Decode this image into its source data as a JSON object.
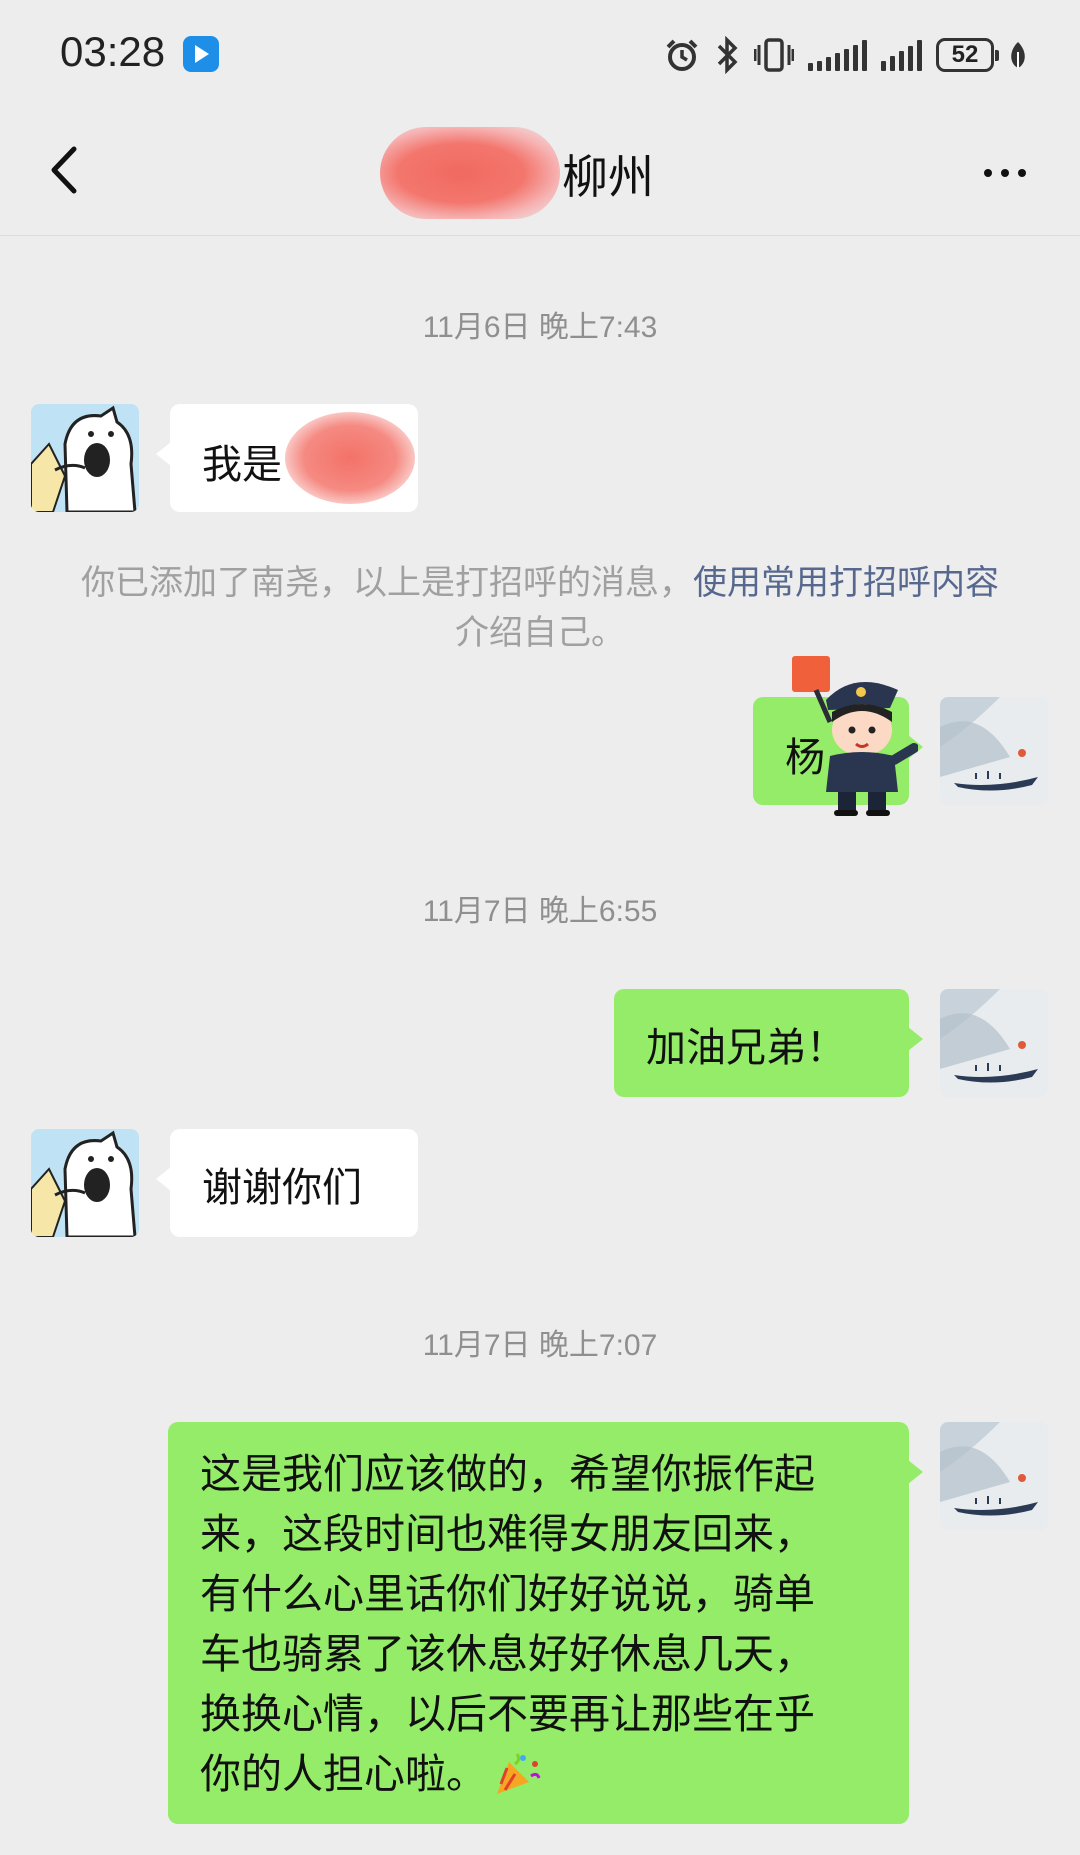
{
  "status_bar": {
    "time": "03:28",
    "battery": "52",
    "icons": [
      "app-badge-icon",
      "alarm-icon",
      "bluetooth-icon",
      "vibrate-icon",
      "signal-icon",
      "signal-icon",
      "battery-icon",
      "leaf-icon"
    ]
  },
  "header": {
    "title": "柳州",
    "back_icon": "chevron-left-icon",
    "more_icon": "more-dots-icon"
  },
  "messages": [
    {
      "type": "timestamp",
      "text": "11月6日 晚上7:43"
    },
    {
      "type": "incoming",
      "text": "我是"
    },
    {
      "type": "system",
      "text": "你已添加了南尧，以上是打招呼的消息，",
      "link": "使用常用打招呼内容",
      "suffix": "介绍自己。"
    },
    {
      "type": "outgoing",
      "text": "杨"
    },
    {
      "type": "timestamp",
      "text": "11月7日 晚上6:55"
    },
    {
      "type": "outgoing",
      "text": "加油兄弟！"
    },
    {
      "type": "incoming",
      "text": "谢谢你们"
    },
    {
      "type": "timestamp",
      "text": "11月7日 晚上7:07"
    },
    {
      "type": "outgoing",
      "lines": [
        "这是我们应该做的，希望你振作起",
        "来，这段时间也难得女朋友回来，",
        "有什么心里话你们好好说说，骑单",
        "车也骑累了该休息好好休息几天，",
        "换换心情，以后不要再让那些在乎",
        "你的人担心啦。"
      ]
    }
  ],
  "colors": {
    "background": "#ededed",
    "outgoing_bubble": "#95ec69",
    "incoming_bubble": "#ffffff",
    "link": "#57688f",
    "timestamp": "#8f8f8f"
  }
}
